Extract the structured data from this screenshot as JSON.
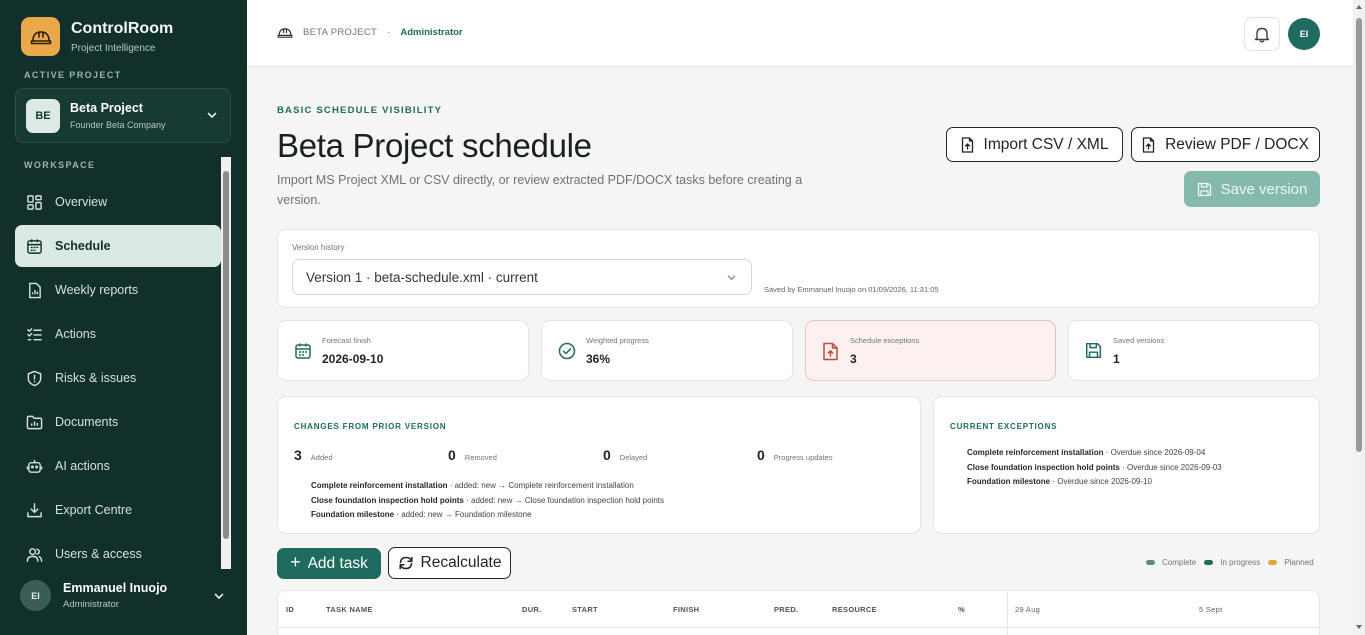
{
  "brand": {
    "name": "ControlRoom",
    "subtitle": "Project Intelligence"
  },
  "sidebar": {
    "active_project_label": "ACTIVE PROJECT",
    "project": {
      "badge": "BE",
      "name": "Beta Project",
      "company": "Founder Beta Company"
    },
    "workspace_label": "WORKSPACE",
    "items": [
      {
        "label": "Overview",
        "icon": "grid-icon"
      },
      {
        "label": "Schedule",
        "icon": "calendar-icon",
        "active": true
      },
      {
        "label": "Weekly reports",
        "icon": "report-icon"
      },
      {
        "label": "Actions",
        "icon": "checklist-icon"
      },
      {
        "label": "Risks & issues",
        "icon": "shield-icon"
      },
      {
        "label": "Documents",
        "icon": "folder-icon"
      },
      {
        "label": "AI actions",
        "icon": "robot-icon"
      },
      {
        "label": "Export Centre",
        "icon": "download-icon"
      },
      {
        "label": "Users & access",
        "icon": "users-icon"
      }
    ],
    "user": {
      "initials": "EI",
      "name": "Emmanuel Inuojo",
      "role": "Administrator"
    }
  },
  "topbar": {
    "project": "BETA PROJECT",
    "separator": "·",
    "role": "Administrator",
    "avatar_initials": "EI"
  },
  "page": {
    "eyebrow": "BASIC SCHEDULE VISIBILITY",
    "title": "Beta Project schedule",
    "description": "Import MS Project XML or CSV directly, or review extracted PDF/DOCX tasks before creating a version.",
    "import_label": "Import CSV / XML",
    "review_label": "Review PDF / DOCX",
    "save_label": "Save version"
  },
  "version_history": {
    "label": "Version history",
    "selected": "Version 1 · beta-schedule.xml · current",
    "saved_by": "Saved by Emmanuel Inuojo on 01/09/2026, 11:31:05"
  },
  "stats": [
    {
      "label": "Forecast finish",
      "value": "2026-09-10",
      "icon": "calendar-icon"
    },
    {
      "label": "Weighted progress",
      "value": "36%",
      "icon": "check-circle-icon"
    },
    {
      "label": "Schedule exceptions",
      "value": "3",
      "icon": "file-alert-icon"
    },
    {
      "label": "Saved versions",
      "value": "1",
      "icon": "save-icon"
    }
  ],
  "changes": {
    "title": "CHANGES FROM PRIOR VERSION",
    "counts": [
      {
        "value": "3",
        "label": "Added"
      },
      {
        "value": "0",
        "label": "Removed"
      },
      {
        "value": "0",
        "label": "Delayed"
      },
      {
        "value": "0",
        "label": "Progress updates"
      }
    ],
    "items": [
      {
        "name": "Complete reinforcement installation",
        "detail": " · added: new → Complete reinforcement installation"
      },
      {
        "name": "Close foundation inspection hold points",
        "detail": " · added: new → Close foundation inspection hold points"
      },
      {
        "name": "Foundation milestone",
        "detail": " · added: new → Foundation milestone"
      }
    ]
  },
  "exceptions": {
    "title": "CURRENT EXCEPTIONS",
    "items": [
      {
        "name": "Complete reinforcement installation",
        "detail": " · Overdue since 2026-09-04"
      },
      {
        "name": "Close foundation inspection hold points",
        "detail": " · Overdue since 2026-09-03"
      },
      {
        "name": "Foundation milestone",
        "detail": " · Overdue since 2026-09-10"
      }
    ]
  },
  "actions": {
    "add_task": "Add task",
    "recalculate": "Recalculate"
  },
  "legend": [
    {
      "label": "Complete",
      "color": "#5e8a7c"
    },
    {
      "label": "In progress",
      "color": "#1f6b5f"
    },
    {
      "label": "Planned",
      "color": "#e0a83a"
    }
  ],
  "table": {
    "columns": [
      "ID",
      "TASK NAME",
      "DUR.",
      "START",
      "FINISH",
      "PRED.",
      "RESOURCE",
      "%"
    ],
    "timeline": [
      "29 Aug",
      "5 Sept"
    ]
  }
}
